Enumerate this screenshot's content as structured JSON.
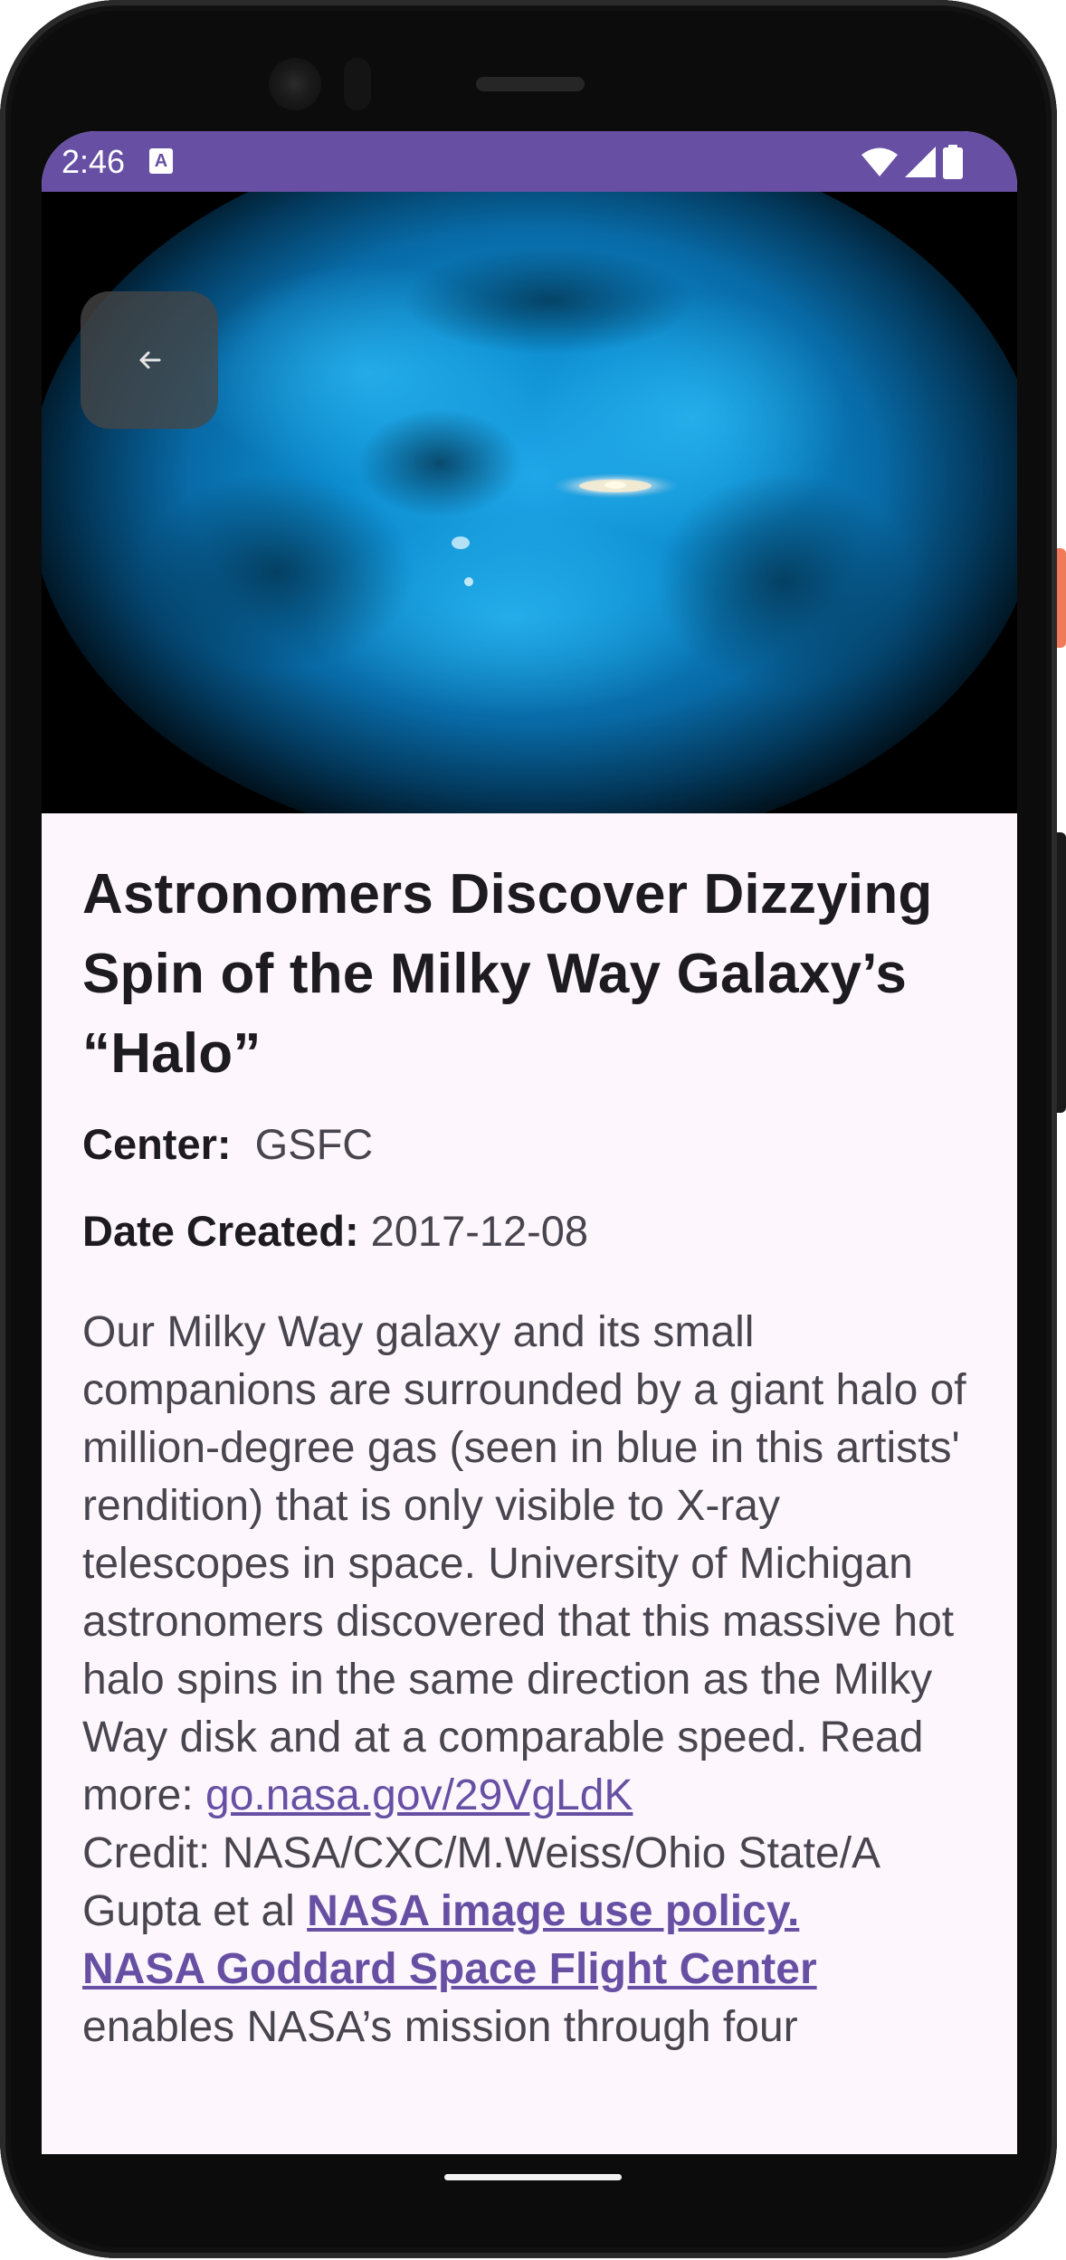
{
  "status_bar": {
    "time": "2:46",
    "notification_icon": "text-a-icon",
    "icons": [
      "wifi-icon",
      "signal-icon",
      "battery-icon"
    ],
    "color": "#6750a4"
  },
  "hero": {
    "image_alt": "galaxy-halo-artwork",
    "back_icon": "arrow-left-icon"
  },
  "article": {
    "title": "Astronomers Discover Dizzying Spin of the Milky Way Galaxy’s “Halo”",
    "center_label": "Center:",
    "center_value": "GSFC",
    "date_label": "Date Created:",
    "date_value": "2017-12-08",
    "description_text": "Our Milky Way galaxy and its small companions are surrounded by a giant halo of million-degree gas (seen in blue in this artists' rendition) that is only visible to X-ray telescopes in space. University of Michigan astronomers discovered that this massive hot halo spins in the same direction as the Milky Way disk and at a comparable speed. Read more: ",
    "read_more_link": "go.nasa.gov/29VgLdK",
    "credit_text": "Credit: NASA/CXC/M.Weiss/Ohio State/A Gupta et al ",
    "policy_link": "NASA image use policy.",
    "goddard_link": "NASA Goddard Space Flight Center",
    "goddard_text": "enables NASA’s mission through four"
  },
  "colors": {
    "accent": "#6750a4",
    "background": "#fdf7fd",
    "title_text": "#1d1b20",
    "body_text": "#49454f"
  }
}
